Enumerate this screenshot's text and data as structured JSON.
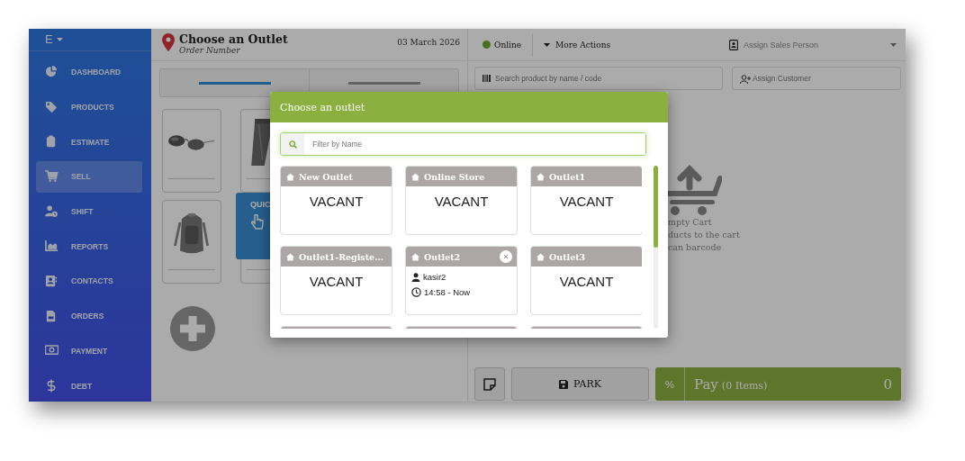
{
  "sidebar": {
    "brand": "E",
    "items": [
      {
        "label": "DASHBOARD",
        "kind": "pie",
        "selected": false
      },
      {
        "label": "PRODUCTS",
        "kind": "tag",
        "selected": false
      },
      {
        "label": "ESTIMATE",
        "kind": "clipboard",
        "selected": false
      },
      {
        "label": "SELL",
        "kind": "cart",
        "selected": true
      },
      {
        "label": "SHIFT",
        "kind": "userclock",
        "selected": false
      },
      {
        "label": "REPORTS",
        "kind": "chart",
        "selected": false
      },
      {
        "label": "CONTACTS",
        "kind": "contacts",
        "selected": false
      },
      {
        "label": "ORDERS",
        "kind": "file",
        "selected": false
      },
      {
        "label": "PAYMENT",
        "kind": "money",
        "selected": false
      },
      {
        "label": "DEBT",
        "kind": "dollar",
        "selected": false
      }
    ]
  },
  "header": {
    "title": "Choose an Outlet",
    "subtitle": "Order Number",
    "date": "03 March 2026",
    "status": "Online",
    "online": true,
    "more_actions": "More Actions",
    "sales_person": {
      "placeholder": "Assign Sales Person"
    }
  },
  "tabs": [
    {
      "selected": true
    },
    {
      "selected": false
    }
  ],
  "products": [
    {
      "kind": "sunglasses"
    },
    {
      "kind": "jeans"
    },
    {
      "kind": "backpack"
    },
    {
      "kind": "blank"
    }
  ],
  "quick_tile": {
    "label": "QUIC"
  },
  "product_search": {
    "placeholder": "Search product by name / code"
  },
  "customer": {
    "placeholder": "Assign Customer"
  },
  "cart": {
    "lines": [
      "mpty Cart",
      "ducts to the cart",
      "can barcode"
    ]
  },
  "bottom": {
    "park": "PARK",
    "discount": "%",
    "pay": "Pay",
    "count": "(0 Items)",
    "total": "0"
  },
  "dialog": {
    "title": "Choose an outlet",
    "filter": {
      "placeholder": "Filter by Name"
    },
    "outlets": [
      {
        "kind": "vacant",
        "name": "New Outlet",
        "status": "VACANT"
      },
      {
        "kind": "vacant",
        "name": "Online Store",
        "status": "VACANT"
      },
      {
        "kind": "vacant",
        "name": "Outlet1",
        "status": "VACANT"
      },
      {
        "kind": "vacant",
        "name": "Outlet1-Registe...",
        "status": "VACANT"
      },
      {
        "kind": "occupied",
        "name": "Outlet2",
        "user": "kasir2",
        "time": "14:58 - Now",
        "closable": true
      },
      {
        "kind": "vacant",
        "name": "Outlet3",
        "status": "VACANT"
      },
      {
        "kind": "partial"
      },
      {
        "kind": "partial"
      },
      {
        "kind": "partial"
      }
    ]
  }
}
